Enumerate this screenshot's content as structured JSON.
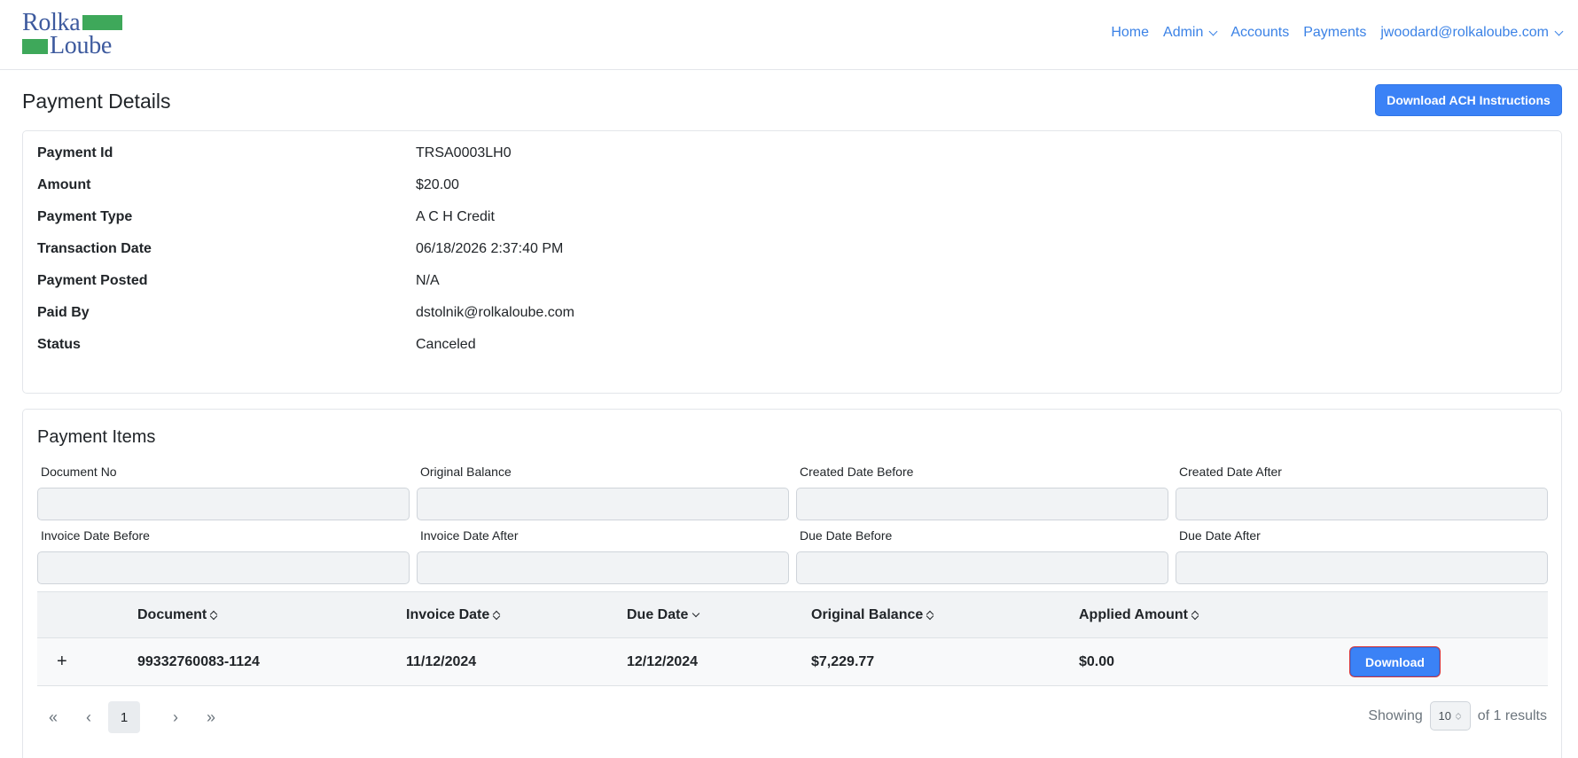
{
  "brand": {
    "line1": "Rolka",
    "line2": "Loube",
    "accent_color": "#3ea85a",
    "text_color": "#3d5a9e"
  },
  "nav": {
    "home": "Home",
    "admin": "Admin",
    "accounts": "Accounts",
    "payments": "Payments",
    "user": "jwoodard@rolkaloube.com",
    "link_color": "#3b82e6"
  },
  "page": {
    "title": "Payment Details",
    "ach_button": "Download ACH Instructions"
  },
  "details": [
    {
      "label": "Payment Id",
      "value": "TRSA0003LH0"
    },
    {
      "label": "Amount",
      "value": "$20.00"
    },
    {
      "label": "Payment Type",
      "value": "A C H Credit"
    },
    {
      "label": "Transaction Date",
      "value": "06/18/2026 2:37:40 PM"
    },
    {
      "label": "Payment Posted",
      "value": "N/A"
    },
    {
      "label": "Paid By",
      "value": "dstolnik@rolkaloube.com"
    },
    {
      "label": "Status",
      "value": "Canceled"
    }
  ],
  "items": {
    "title": "Payment Items",
    "filters": [
      {
        "label": "Document No",
        "value": ""
      },
      {
        "label": "Original Balance",
        "value": ""
      },
      {
        "label": "Created Date Before",
        "value": ""
      },
      {
        "label": "Created Date After",
        "value": ""
      },
      {
        "label": "Invoice Date Before",
        "value": ""
      },
      {
        "label": "Invoice Date After",
        "value": ""
      },
      {
        "label": "Due Date Before",
        "value": ""
      },
      {
        "label": "Due Date After",
        "value": ""
      }
    ],
    "columns": [
      "Document",
      "Invoice Date",
      "Due Date",
      "Original Balance",
      "Applied Amount"
    ],
    "rows": [
      {
        "expand": "+",
        "document": "99332760083-1124",
        "invoice_date": "11/12/2024",
        "due_date": "12/12/2024",
        "original_balance": "$7,229.77",
        "applied_amount": "$0.00",
        "action": "Download"
      }
    ],
    "pagination": {
      "first": "«",
      "prev": "‹",
      "page": "1",
      "next": "›",
      "last": "»",
      "showing_label": "Showing",
      "page_size": "10",
      "results_label": "of 1 results"
    }
  },
  "colors": {
    "primary": "#3b82f6",
    "primary_border": "#2f74e6",
    "highlight_outline": "#d4333b"
  }
}
